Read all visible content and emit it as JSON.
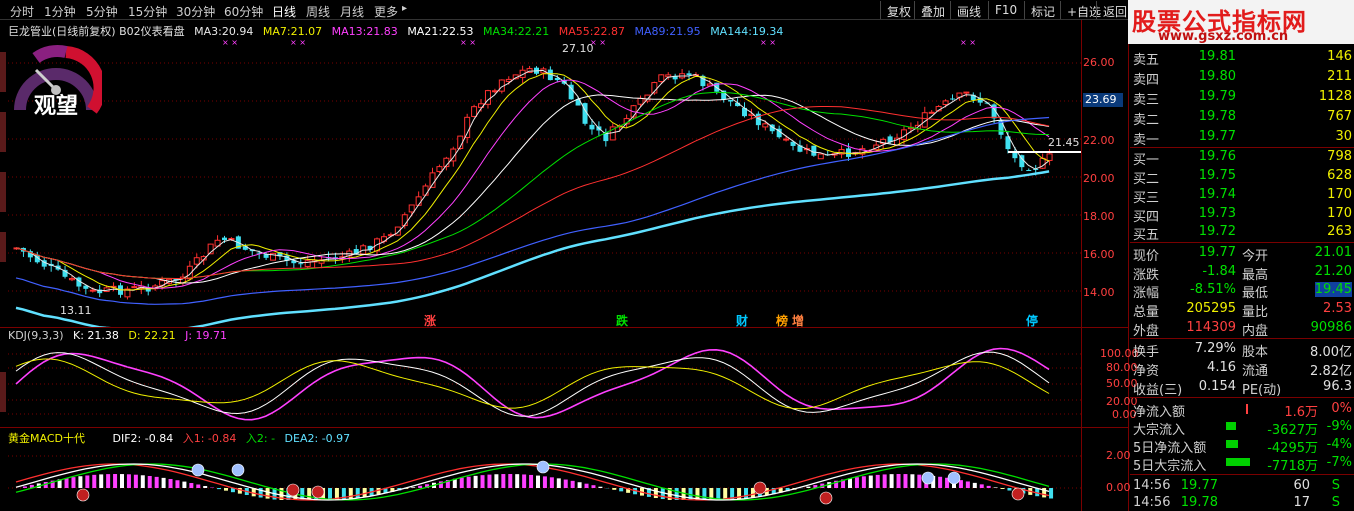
{
  "toolbar": {
    "periods": [
      "分时",
      "1分钟",
      "5分钟",
      "15分钟",
      "30分钟",
      "60分钟",
      "日线",
      "周线",
      "月线",
      "更多"
    ],
    "active": "日线",
    "more_arrow": "▸",
    "buttons": [
      "复权",
      "叠加",
      "画线",
      "F10",
      "标记",
      "+自选",
      "返回"
    ]
  },
  "main_chart": {
    "title": "巨龙管业(日线前复权) B02仪表看盘",
    "ma": [
      {
        "label": "MA3:",
        "value": "20.94",
        "color": "#e8e8e8"
      },
      {
        "label": "MA7:",
        "value": "21.07",
        "color": "#f0f000"
      },
      {
        "label": "MA13:",
        "value": "21.83",
        "color": "#ff40ff"
      },
      {
        "label": "MA21:",
        "value": "22.53",
        "color": "#ffffff"
      },
      {
        "label": "MA34:",
        "value": "22.21",
        "color": "#00e000"
      },
      {
        "label": "MA55:",
        "value": "22.87",
        "color": "#ff3030"
      },
      {
        "label": "MA89:",
        "value": "21.95",
        "color": "#4060ff"
      },
      {
        "label": "MA144:",
        "value": "19.34",
        "color": "#60e0ff"
      }
    ],
    "gauge_label": "观望",
    "high_label": "27.10",
    "low_label": "13.11",
    "last_label": "21.45",
    "price_tag": "23.69",
    "y_ticks": [
      "26.00",
      "24.00",
      "22.00",
      "20.00",
      "18.00",
      "16.00",
      "14.00"
    ],
    "signals": [
      {
        "text": "涨",
        "color": "#ff4040"
      },
      {
        "text": "跌",
        "color": "#00e000"
      },
      {
        "text": "财",
        "color": "#00c8ff"
      },
      {
        "text": "榜",
        "color": "#ffa000"
      },
      {
        "text": "增",
        "color": "#ff8040"
      },
      {
        "text": "停",
        "color": "#00c8ff"
      }
    ],
    "marks": "× ×"
  },
  "kdj": {
    "title": "KDJ(9,3,3)",
    "k": "K: 21.38",
    "d": "D: 22.21",
    "j": "J: 19.71",
    "y_ticks": [
      "100.00",
      "80.00",
      "50.00",
      "20.00",
      "0.00"
    ]
  },
  "macd": {
    "title": "黄金MACD十代",
    "dif": "DIF2: -0.84",
    "in1": "入1: -0.84",
    "in2": "入2: -",
    "dea": "DEA2: -0.97",
    "y_ticks": [
      "2.00",
      "0.00"
    ]
  },
  "logo": {
    "main": "股票公式指标网",
    "url": "www.gsxz.com.cn"
  },
  "orderbook": {
    "asks": [
      {
        "label": "卖五",
        "price": "19.81",
        "vol": "146"
      },
      {
        "label": "卖四",
        "price": "19.80",
        "vol": "211"
      },
      {
        "label": "卖三",
        "price": "19.79",
        "vol": "1128"
      },
      {
        "label": "卖二",
        "price": "19.78",
        "vol": "767"
      },
      {
        "label": "卖一",
        "price": "19.77",
        "vol": "30"
      }
    ],
    "bids": [
      {
        "label": "买一",
        "price": "19.76",
        "vol": "798"
      },
      {
        "label": "买二",
        "price": "19.75",
        "vol": "628"
      },
      {
        "label": "买三",
        "price": "19.74",
        "vol": "170"
      },
      {
        "label": "买四",
        "price": "19.73",
        "vol": "170"
      },
      {
        "label": "买五",
        "price": "19.72",
        "vol": "263"
      }
    ]
  },
  "quote": [
    {
      "l1": "现价",
      "v1": "19.77",
      "c1": "#00e000",
      "l2": "今开",
      "v2": "21.01",
      "c2": "#00e000"
    },
    {
      "l1": "涨跌",
      "v1": "-1.84",
      "c1": "#00e000",
      "l2": "最高",
      "v2": "21.20",
      "c2": "#00e000"
    },
    {
      "l1": "涨幅",
      "v1": "-8.51%",
      "c1": "#00e000",
      "l2": "最低",
      "v2": "19.45",
      "c2": "#00e000"
    },
    {
      "l1": "总量",
      "v1": "205295",
      "c1": "#f0f000",
      "l2": "量比",
      "v2": "2.53",
      "c2": "#ff4040"
    },
    {
      "l1": "外盘",
      "v1": "114309",
      "c1": "#ff4040",
      "l2": "内盘",
      "v2": "90986",
      "c2": "#00e000"
    }
  ],
  "fundamentals": [
    {
      "l1": "换手",
      "v1": "7.29%",
      "l2": "股本",
      "v2": "8.00亿"
    },
    {
      "l1": "净资",
      "v1": "4.16",
      "l2": "流通",
      "v2": "2.82亿"
    },
    {
      "l1": "收益(三)",
      "v1": "0.154",
      "l2": "PE(动)",
      "v2": "96.3"
    }
  ],
  "flows": [
    {
      "label": "净流入额",
      "value": "1.6万",
      "pct": "0%",
      "color": "#ff4040"
    },
    {
      "label": "大宗流入",
      "value": "-3627万",
      "pct": "-9%",
      "color": "#00e000"
    },
    {
      "label": "5日净流入额",
      "value": "-4295万",
      "pct": "-4%",
      "color": "#00e000"
    },
    {
      "label": "5日大宗流入",
      "value": "-7718万",
      "pct": "-7%",
      "color": "#00e000"
    }
  ],
  "ticks": [
    {
      "time": "14:56",
      "price": "19.77",
      "vol": "60",
      "side": "S"
    },
    {
      "time": "14:56",
      "price": "19.78",
      "vol": "17",
      "side": "S"
    }
  ]
}
